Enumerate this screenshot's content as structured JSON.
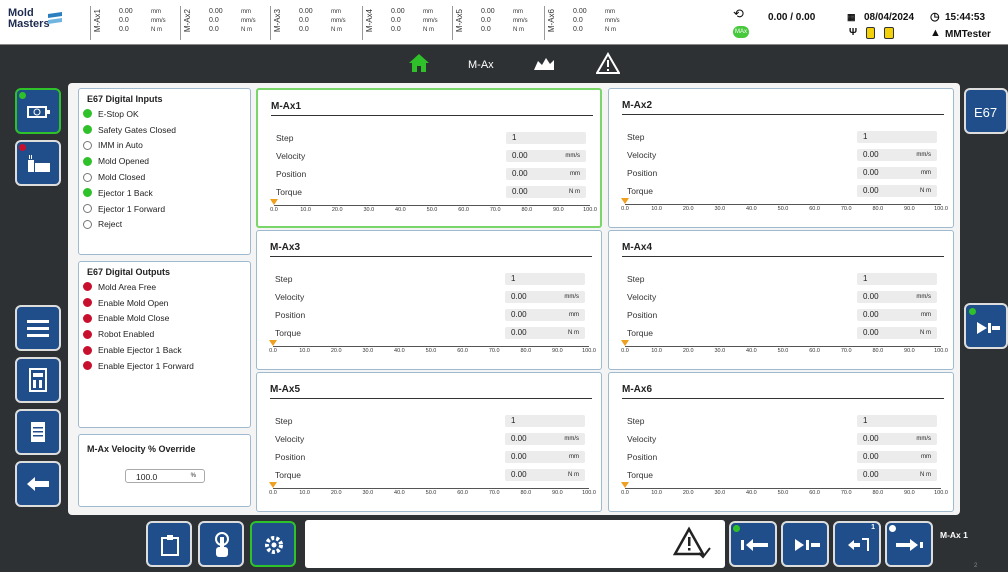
{
  "brand": {
    "line1": "Mold",
    "line2": "Masters"
  },
  "top_axes": [
    {
      "name": "M-Ax1",
      "vals": [
        "0.00",
        "0.0",
        "0.0"
      ],
      "units": [
        "mm",
        "mm/s",
        "N m"
      ]
    },
    {
      "name": "M-Ax2",
      "vals": [
        "0.00",
        "0.0",
        "0.0"
      ],
      "units": [
        "mm",
        "mm/s",
        "N m"
      ]
    },
    {
      "name": "M-Ax3",
      "vals": [
        "0.00",
        "0.0",
        "0.0"
      ],
      "units": [
        "mm",
        "mm/s",
        "N m"
      ]
    },
    {
      "name": "M-Ax4",
      "vals": [
        "0.00",
        "0.0",
        "0.0"
      ],
      "units": [
        "mm",
        "mm/s",
        "N m"
      ]
    },
    {
      "name": "M-Ax5",
      "vals": [
        "0.00",
        "0.0",
        "0.0"
      ],
      "units": [
        "mm",
        "mm/s",
        "N m"
      ]
    },
    {
      "name": "M-Ax6",
      "vals": [
        "0.00",
        "0.0",
        "0.0"
      ],
      "units": [
        "mm",
        "mm/s",
        "N m"
      ]
    }
  ],
  "status": {
    "counter": "0.00 / 0.00",
    "mode_badge": "MAx",
    "date": "08/04/2024",
    "time": "15:44:53",
    "user": "MMTester"
  },
  "nav": {
    "title": "M-Ax"
  },
  "inputs": {
    "title": "E67 Digital Inputs",
    "items": [
      {
        "label": "E-Stop OK",
        "state": "green"
      },
      {
        "label": "Safety Gates Closed",
        "state": "green"
      },
      {
        "label": "IMM in Auto",
        "state": "off"
      },
      {
        "label": "Mold Opened",
        "state": "green"
      },
      {
        "label": "Mold Closed",
        "state": "off"
      },
      {
        "label": "Ejector 1 Back",
        "state": "green"
      },
      {
        "label": "Ejector 1 Forward",
        "state": "off"
      },
      {
        "label": "Reject",
        "state": "off"
      }
    ]
  },
  "outputs": {
    "title": "E67 Digital Outputs",
    "items": [
      {
        "label": "Mold Area Free",
        "state": "red"
      },
      {
        "label": "Enable Mold Open",
        "state": "red"
      },
      {
        "label": "Enable Mold Close",
        "state": "red"
      },
      {
        "label": "Robot Enabled",
        "state": "red"
      },
      {
        "label": "Enable Ejector 1 Back",
        "state": "red"
      },
      {
        "label": "Enable Ejector 1 Forward",
        "state": "red"
      }
    ]
  },
  "override": {
    "title": "M-Ax Velocity % Override",
    "value": "100.0",
    "unit": "%"
  },
  "field_labels": [
    "Step",
    "Velocity",
    "Position",
    "Torque"
  ],
  "axes": [
    {
      "title": "M-Ax1",
      "step": "1",
      "velocity": "0.00",
      "position": "0.00",
      "torque": "0.00"
    },
    {
      "title": "M-Ax2",
      "step": "1",
      "velocity": "0.00",
      "position": "0.00",
      "torque": "0.00"
    },
    {
      "title": "M-Ax3",
      "step": "1",
      "velocity": "0.00",
      "position": "0.00",
      "torque": "0.00"
    },
    {
      "title": "M-Ax4",
      "step": "1",
      "velocity": "0.00",
      "position": "0.00",
      "torque": "0.00"
    },
    {
      "title": "M-Ax5",
      "step": "1",
      "velocity": "0.00",
      "position": "0.00",
      "torque": "0.00"
    },
    {
      "title": "M-Ax6",
      "step": "1",
      "velocity": "0.00",
      "position": "0.00",
      "torque": "0.00"
    }
  ],
  "units": {
    "velocity": "mm/s",
    "position": "mm",
    "torque": "N m"
  },
  "scale_ticks": [
    "0.0",
    "10.0",
    "20.0",
    "30.0",
    "40.0",
    "50.0",
    "60.0",
    "70.0",
    "80.0",
    "90.0",
    "100.0"
  ],
  "right": {
    "e67": "E67"
  },
  "bottom": {
    "ejector_step": "1",
    "axis_status": "M-Ax 1",
    "axis_sub": "2"
  },
  "colors": {
    "green": "#2fc12a",
    "red": "#c8102e",
    "blue": "#1f4e8a"
  }
}
